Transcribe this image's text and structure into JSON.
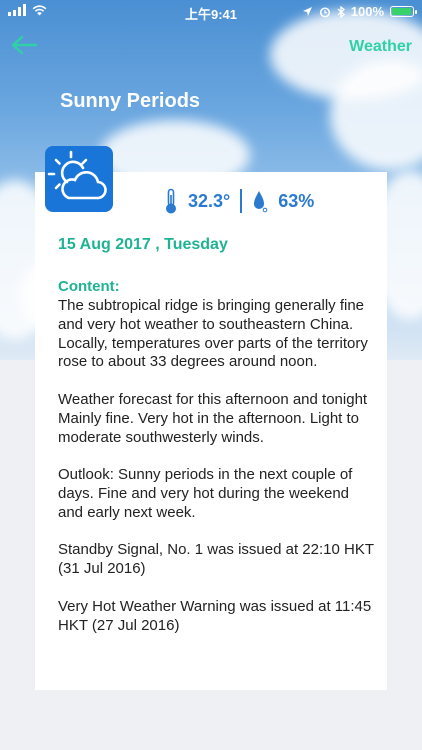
{
  "status_bar": {
    "time": "上午9:41",
    "battery_percent": "100%",
    "battery_level": 1.0
  },
  "nav": {
    "back_icon": "arrow-left-icon",
    "title": "Weather"
  },
  "weather": {
    "condition": "Sunny Periods",
    "icon": "sun-behind-cloud-icon",
    "temperature": "32.3°",
    "humidity": "63%",
    "date": "15 Aug 2017 , Tuesday"
  },
  "content": {
    "label": "Content:",
    "text": "The subtropical ridge is bringing generally fine and very hot weather to southeastern China. Locally, temperatures over parts of the territory rose to about 33 degrees around noon.\n\nWeather forecast for this afternoon and tonight\nMainly fine. Very hot in the afternoon. Light to moderate southwesterly winds.\n\nOutlook: Sunny periods in the next couple of days. Fine and very hot during the weekend and early next week.\n\nStandby Signal, No. 1 was issued at 22:10 HKT (31 Jul 2016)\n\nVery Hot Weather Warning was issued at 11:45 HKT (27 Jul 2016)"
  },
  "colors": {
    "accent": "#2fd1a6",
    "date": "#1fb393",
    "stats": "#2b7ad0",
    "icon_bg": "#1976d8"
  }
}
